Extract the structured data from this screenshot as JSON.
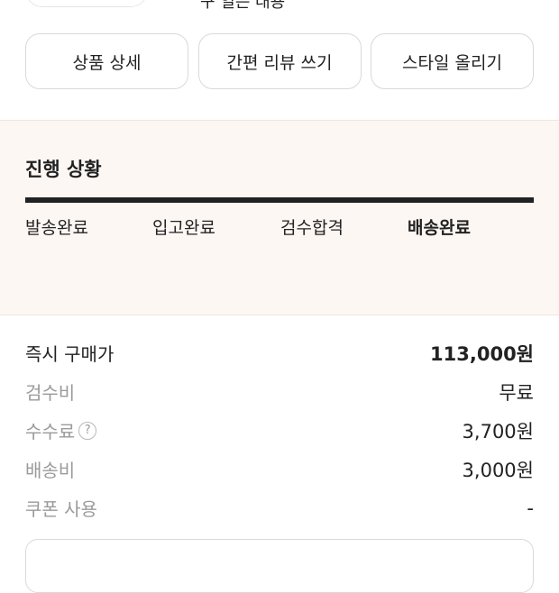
{
  "top": {
    "partial_text": "구 일은 대용"
  },
  "actions": [
    {
      "label": "상품 상세"
    },
    {
      "label": "간편 리뷰 쓰기"
    },
    {
      "label": "스타일 올리기"
    }
  ],
  "progress": {
    "title": "진행 상황",
    "steps": [
      {
        "label": "발송완료",
        "active": false
      },
      {
        "label": "입고완료",
        "active": false
      },
      {
        "label": "검수합격",
        "active": false
      },
      {
        "label": "배송완료",
        "active": true
      }
    ],
    "bar_color": "#222222"
  },
  "price": {
    "rows": [
      {
        "label": "즉시 구매가",
        "value": "113,000원"
      },
      {
        "label": "검수비",
        "value": "무료"
      },
      {
        "label": "수수료",
        "value": "3,700원",
        "help_icon": "question-circle-icon",
        "help_glyph": "?"
      },
      {
        "label": "배송비",
        "value": "3,000원"
      },
      {
        "label": "쿠폰 사용",
        "value": "-"
      }
    ]
  },
  "colors": {
    "progress_background": "#fdf7f4",
    "muted_text": "#9a9a9a",
    "primary_text": "#222222"
  }
}
